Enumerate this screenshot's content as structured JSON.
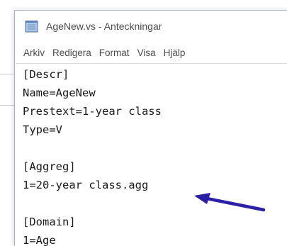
{
  "window": {
    "title": "AgeNew.vs - Anteckningar",
    "icon": "notepad-icon"
  },
  "menu": {
    "items": [
      {
        "label": "Arkiv"
      },
      {
        "label": "Redigera"
      },
      {
        "label": "Format"
      },
      {
        "label": "Visa"
      },
      {
        "label": "Hjälp"
      }
    ]
  },
  "editor": {
    "lines": [
      "[Descr]",
      "Name=AgeNew",
      "Prestext=1-year class",
      "Type=V",
      "",
      "[Aggreg]",
      "1=20-year class.agg",
      "",
      "[Domain]",
      "1=Age"
    ]
  },
  "annotation": {
    "arrow_color": "#2b1fa6",
    "arrow_icon": "arrow-left-icon"
  }
}
